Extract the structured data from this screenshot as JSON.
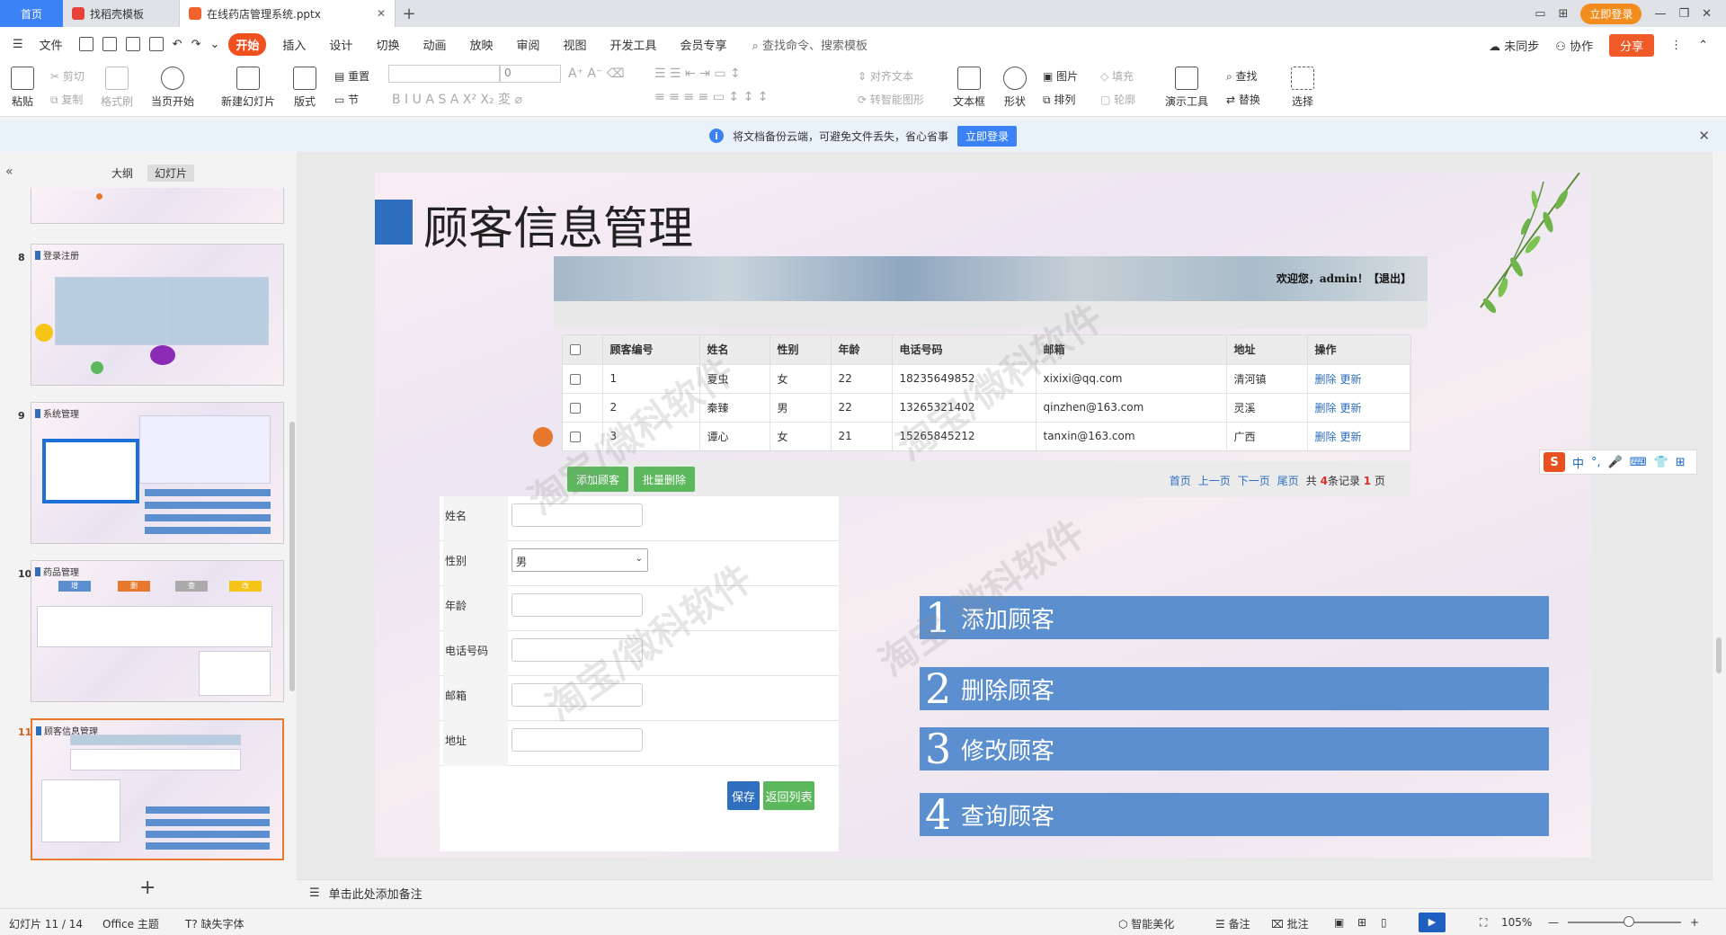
{
  "tabs": {
    "home": "首页",
    "template": "找稻壳模板",
    "file": "在线药店管理系统.pptx",
    "login": "立即登录"
  },
  "menu": {
    "file": "文件",
    "items": [
      "开始",
      "插入",
      "设计",
      "切换",
      "动画",
      "放映",
      "审阅",
      "视图",
      "开发工具",
      "会员专享"
    ],
    "search": "查找命令、搜索模板",
    "sync": "未同步",
    "collab": "协作",
    "share": "分享"
  },
  "ribbon": {
    "paste": "粘贴",
    "cut": "剪切",
    "copy": "复制",
    "format_painter": "格式刷",
    "from_start": "当页开始",
    "new_slide": "新建幻灯片",
    "layout": "版式",
    "reset": "重置",
    "section": "节",
    "font_size": "0",
    "align_text": "对齐文本",
    "smart_art": "转智能图形",
    "textbox": "文本框",
    "shape": "形状",
    "picture": "图片",
    "arrange": "排列",
    "fill": "填充",
    "outline": "轮廓",
    "present_tool": "演示工具",
    "find": "查找",
    "replace": "替换",
    "select": "选择"
  },
  "notification": {
    "text": "将文档备份云端，可避免文件丢失，省心省事",
    "button": "立即登录"
  },
  "panel": {
    "outline_tab": "大纲",
    "slides_tab": "幻灯片",
    "thumbs": [
      {
        "num": "8",
        "title": "登录注册"
      },
      {
        "num": "9",
        "title": "系统管理"
      },
      {
        "num": "10",
        "title": "药品管理"
      },
      {
        "num": "11",
        "title": "顾客信息管理"
      }
    ],
    "thumb10_tags": [
      "增",
      "删",
      "查",
      "改"
    ],
    "add": "+"
  },
  "slide": {
    "title": "顾客信息管理",
    "welcome": "欢迎您，admin！【退出】",
    "table": {
      "headers": [
        "顾客编号",
        "姓名",
        "性别",
        "年龄",
        "电话号码",
        "邮箱",
        "地址",
        "操作"
      ],
      "rows": [
        [
          "1",
          "夏虫",
          "女",
          "22",
          "18235649852",
          "xixixi@qq.com",
          "清河镇",
          "删除",
          "更新"
        ],
        [
          "2",
          "秦臻",
          "男",
          "22",
          "13265321402",
          "qinzhen@163.com",
          "灵溪",
          "删除",
          "更新"
        ],
        [
          "3",
          "谭心",
          "女",
          "21",
          "15265845212",
          "tanxin@163.com",
          "广西",
          "删除",
          "更新"
        ]
      ]
    },
    "add_btn": "添加顾客",
    "batch_delete_btn": "批量删除",
    "pager": {
      "first": "首页",
      "prev": "上一页",
      "next": "下一页",
      "last": "尾页",
      "total_prefix": "共",
      "total_count": "4",
      "total_suffix": "条记录",
      "pages": "1",
      "pages_suffix": "页"
    },
    "form": {
      "labels": [
        "姓名",
        "性别",
        "年龄",
        "电话号码",
        "邮箱",
        "地址"
      ],
      "gender_value": "男",
      "save": "保存",
      "back": "返回列表"
    },
    "features": [
      {
        "num": "1",
        "label": "添加顾客"
      },
      {
        "num": "2",
        "label": "删除顾客"
      },
      {
        "num": "3",
        "label": "修改顾客"
      },
      {
        "num": "4",
        "label": "查询顾客"
      }
    ],
    "watermark": "淘宝/微科软件"
  },
  "ime": {
    "lang": "中",
    "punct": "°,"
  },
  "notes": "单击此处添加备注",
  "status": {
    "slide_pos": "幻灯片 11 / 14",
    "theme": "Office 主题",
    "missing_font": "缺失字体",
    "beautify": "智能美化",
    "notes": "备注",
    "comment": "批注",
    "zoom": "105%"
  },
  "colors": {
    "accent_blue": "#2f6fbf",
    "feature_blue": "#5c8fcf",
    "green": "#5cb85c",
    "orange": "#e8782d",
    "start_tab": "#f04f1e"
  }
}
